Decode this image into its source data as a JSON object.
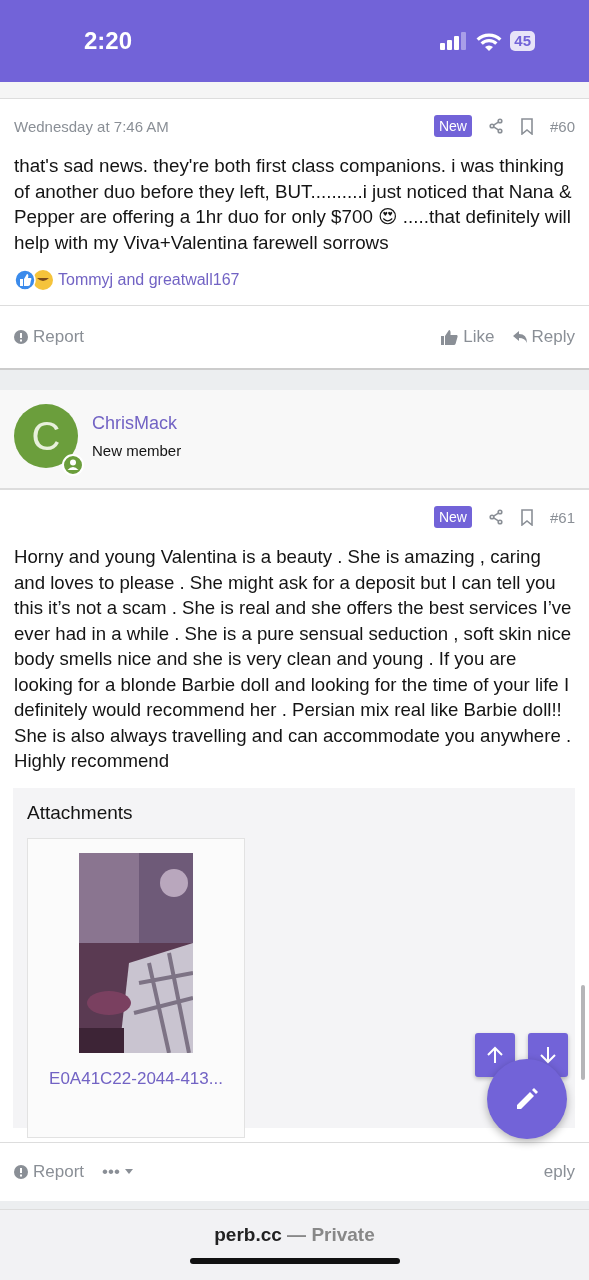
{
  "status_bar": {
    "time": "2:20",
    "battery": "45"
  },
  "posts": [
    {
      "date": "Wednesday at 7:46 AM",
      "badge": "New",
      "number": "#60",
      "body": "that's sad news. they're both first class companions. i was thinking of another duo before they left, BUT..........i just noticed that Nana & Pepper are offering a 1hr duo for only $700 😍 .....that definitely will help with my Viva+Valentina farewell sorrows",
      "reactions": "Tommyj and greatwall167",
      "actions_left": [
        "Report"
      ],
      "actions_right": [
        "Like",
        "Reply"
      ]
    },
    {
      "author": {
        "initial": "C",
        "name": "ChrisMack",
        "title": "New member"
      },
      "badge": "New",
      "number": "#61",
      "body": "Horny and young Valentina is a beauty . She is amazing , caring and loves to please . She might ask for a deposit but I can tell you this it’s not a scam . She is real and she offers the best services I’ve ever had in a while . She is a pure sensual seduction , soft skin nice body smells nice and she is very clean and young . If you are looking for a blonde Barbie doll and looking for the time of your life I definitely would recommend her . Persian mix real like Barbie doll!! She is also always travelling and can accommodate you anywhere . Highly recommend",
      "attachments": {
        "title": "Attachments",
        "files": [
          {
            "kind": "picture",
            "name": "E0A41C22-2044-413..."
          }
        ]
      },
      "actions_left": [
        "Report",
        "•••"
      ],
      "actions_right": [
        "eply"
      ]
    }
  ],
  "browser": {
    "domain": "perb.cc",
    "mode": "— Private"
  }
}
